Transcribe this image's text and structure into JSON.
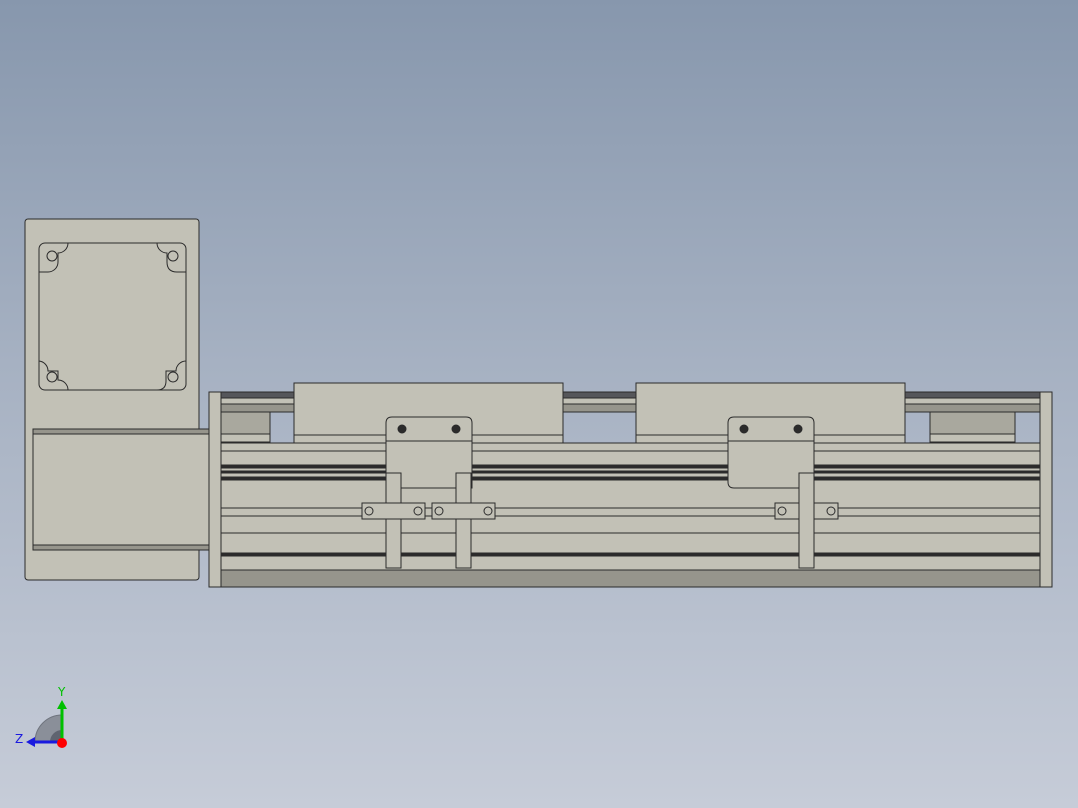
{
  "viewport": {
    "background_top": "#8797ad",
    "background_bottom": "#c6ccd8"
  },
  "model": {
    "part_fill": "#c2c1b6",
    "part_edge": "#2b2b2b",
    "shadow_fill": "#96958c",
    "rail_dark": "#55565a"
  },
  "triad": {
    "x_label": "",
    "y_label": "Y",
    "z_label": "Z",
    "x_color": "#ff0000",
    "y_color": "#00c000",
    "z_color": "#1a1adf"
  }
}
